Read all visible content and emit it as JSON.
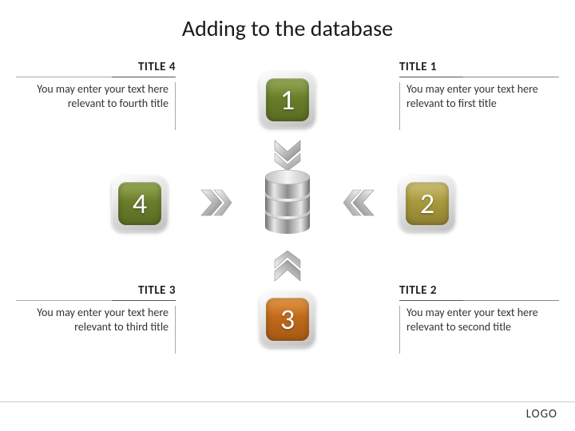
{
  "title": "Adding to the database",
  "blocks": {
    "t1": {
      "title": "TITLE 1",
      "body": "You may enter your text here relevant to first title"
    },
    "t2": {
      "title": "TITLE 2",
      "body": "You may enter your text here relevant to second title"
    },
    "t3": {
      "title": "TITLE 3",
      "body": "You may enter your text here relevant to third title"
    },
    "t4": {
      "title": "TITLE 4",
      "body": "You may enter your text here relevant to fourth title"
    }
  },
  "tiles": {
    "n1": "1",
    "n2": "2",
    "n3": "3",
    "n4": "4"
  },
  "logo": "LOGO"
}
